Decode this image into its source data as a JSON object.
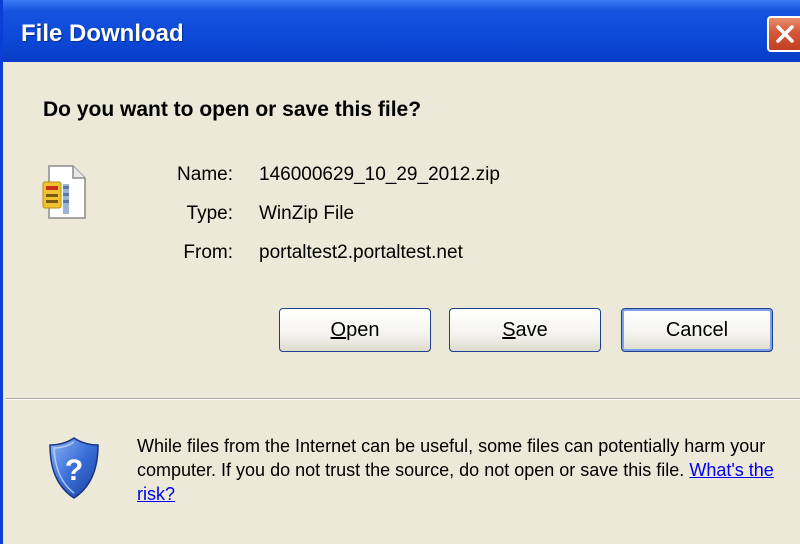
{
  "window": {
    "title": "File Download",
    "close_icon": "close-icon"
  },
  "prompt": {
    "question": "Do you want to open or save this file?"
  },
  "file": {
    "icon": "winzip-file-icon",
    "name_label": "Name:",
    "name_value": "146000629_10_29_2012.zip",
    "type_label": "Type:",
    "type_value": "WinZip File",
    "from_label": "From:",
    "from_value": "portaltest2.portaltest.net"
  },
  "buttons": {
    "open_mnemonic": "O",
    "open_rest": "pen",
    "save_mnemonic": "S",
    "save_rest": "ave",
    "cancel_label": "Cancel"
  },
  "warning": {
    "icon": "shield-question-icon",
    "text": "While files from the Internet can be useful, some files can potentially harm your computer. If you do not trust the source, do not open or save this file.",
    "link": "What's the risk?"
  },
  "colors": {
    "titlebar": "#0c49d8",
    "dialog_bg": "#ece9d8",
    "close_button": "#d5573a",
    "link": "#0000ee"
  }
}
